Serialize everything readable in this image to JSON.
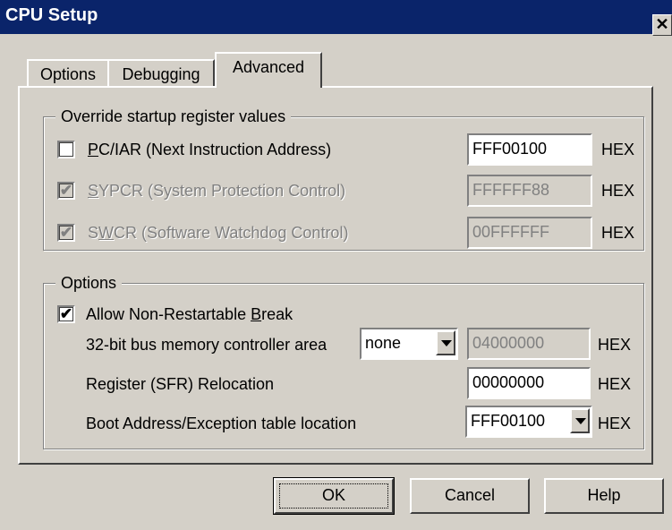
{
  "window": {
    "title": "CPU Setup",
    "close_glyph": "✕"
  },
  "tabs": [
    {
      "label": "Options",
      "active": false
    },
    {
      "label": "Debugging",
      "active": false
    },
    {
      "label": "Advanced",
      "active": true
    }
  ],
  "override_group": {
    "legend": "Override startup register values",
    "rows": [
      {
        "label": "PC/IAR (Next Instruction Address)",
        "accel": "P",
        "label_rest": "C/IAR (Next Instruction Address)",
        "checked": false,
        "enabled": true,
        "value": "FFF00100",
        "unit": "HEX"
      },
      {
        "label": "SYPCR (System Protection Control)",
        "accel": "S",
        "label_rest": "YPCR (System Protection Control)",
        "checked": true,
        "enabled": false,
        "value": "FFFFFF88",
        "unit": "HEX"
      },
      {
        "label": "SWCR (Software Watchdog Control)",
        "accel_pre": "S",
        "accel": "W",
        "label_rest": "CR (Software Watchdog Control)",
        "checked": true,
        "enabled": false,
        "value": "00FFFFFF",
        "unit": "HEX"
      }
    ]
  },
  "options_group": {
    "legend": "Options",
    "allow_break": {
      "label_pre": "Allow Non-Restartable ",
      "accel": "B",
      "label_rest": "reak",
      "checked": true
    },
    "bus_area": {
      "label": "32-bit bus memory controller area",
      "select_value": "none",
      "value": "04000000",
      "unit": "HEX"
    },
    "sfr_relocation": {
      "label": "Register (SFR) Relocation",
      "value": "00000000",
      "unit": "HEX"
    },
    "boot_address": {
      "label": "Boot Address/Exception table location",
      "value": "FFF00100",
      "unit": "HEX"
    }
  },
  "buttons": {
    "ok": "OK",
    "cancel": "Cancel",
    "help": "Help"
  },
  "glyphs": {
    "check": "✔"
  },
  "colors": {
    "titlebar": "#0a246a",
    "face": "#d4d0c8",
    "disabled_text": "#808080"
  }
}
